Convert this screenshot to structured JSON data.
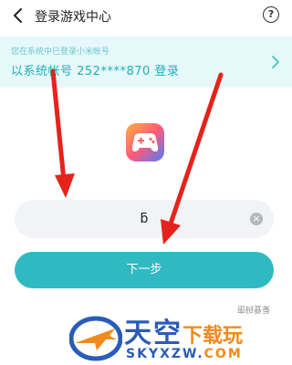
{
  "header": {
    "title": "登录游戏中心",
    "help_label": "?"
  },
  "banner": {
    "subtitle": "您在系统中已登录小米帐号",
    "main_text": "以系统帐号 252****870 登录"
  },
  "login": {
    "input_value": "ƃ",
    "clear_symbol": "×",
    "next_label": "下一步",
    "password_link": "密码登录"
  },
  "watermark": {
    "name_main": "天空",
    "name_accent": "下载玩",
    "url_main": "SKYXZW.",
    "url_accent": "COM"
  },
  "icons": {
    "back": "chevron-left-icon",
    "help": "question-circle-icon",
    "banner_next": "chevron-right-icon",
    "app": "gamepad-app-icon",
    "clear": "clear-circle-icon"
  },
  "colors": {
    "accent": "#2fbac1",
    "banner_bg": "#e6f8f9",
    "banner_text": "#1fb1bb",
    "input_bg": "#f2f3f5",
    "annotation_arrow": "#e5231b",
    "watermark_blue": "#2a5cb8",
    "watermark_orange": "#f08a1c"
  }
}
